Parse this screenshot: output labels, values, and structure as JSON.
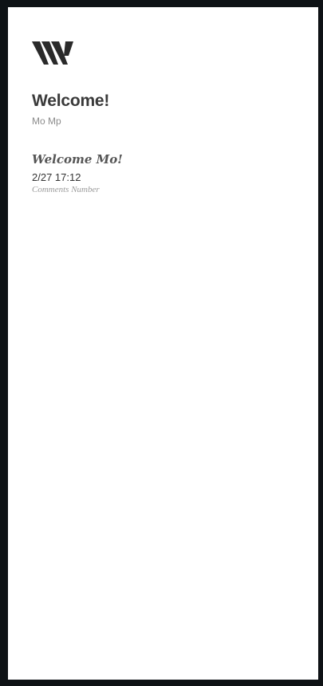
{
  "header": {
    "logo_icon": "brand-w-logo-icon",
    "title": "Welcome!",
    "user_name": "Mo Mp"
  },
  "post": {
    "title": "Welcome Mo!",
    "timestamp": "2/27 17:12",
    "comments_label": "Comments Number"
  },
  "colors": {
    "frame_background": "#0e1215",
    "page_background": "#ffffff",
    "logo": "#2a2a2a"
  }
}
